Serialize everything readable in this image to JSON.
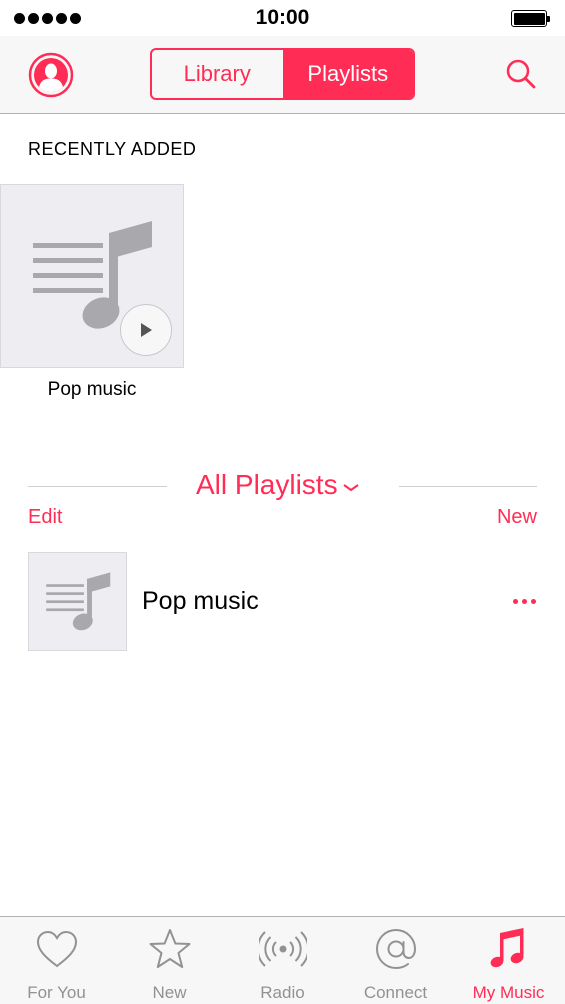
{
  "status_bar": {
    "time": "10:00"
  },
  "nav": {
    "segments": [
      {
        "label": "Library",
        "selected": false
      },
      {
        "label": "Playlists",
        "selected": true
      }
    ]
  },
  "recently_added": {
    "title": "RECENTLY ADDED",
    "items": [
      {
        "title": "Pop music"
      }
    ]
  },
  "playlists": {
    "header": "All Playlists",
    "edit_label": "Edit",
    "new_label": "New",
    "items": [
      {
        "title": "Pop music"
      }
    ]
  },
  "tabs": [
    {
      "label": "For You",
      "icon": "heart-icon",
      "active": false
    },
    {
      "label": "New",
      "icon": "star-icon",
      "active": false
    },
    {
      "label": "Radio",
      "icon": "radio-icon",
      "active": false
    },
    {
      "label": "Connect",
      "icon": "at-icon",
      "active": false
    },
    {
      "label": "My Music",
      "icon": "music-note-icon",
      "active": true
    }
  ],
  "colors": {
    "accent": "#ff2d55",
    "inactive_tab": "#929292",
    "artwork_bg": "#ededf2",
    "artwork_glyph": "#a8a8ad"
  }
}
